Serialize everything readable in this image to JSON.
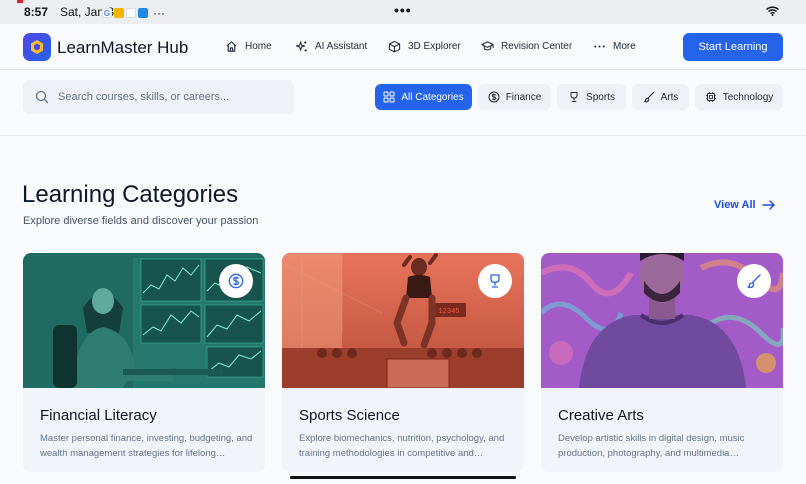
{
  "status": {
    "time": "8:57",
    "date": "Sat, Jan 3",
    "dots": "•••",
    "more": "···"
  },
  "nav": {
    "brand": "LearnMaster Hub",
    "items": [
      {
        "label": "Home",
        "icon": "home-icon"
      },
      {
        "label": "AI Assistant",
        "icon": "sparkles-icon"
      },
      {
        "label": "3D Explorer",
        "icon": "cube-icon"
      },
      {
        "label": "Revision Center",
        "icon": "graduation-cap-icon"
      },
      {
        "label": "More",
        "icon": "ellipsis-icon"
      }
    ],
    "cta": "Start Learning"
  },
  "search": {
    "placeholder": "Search courses, skills, or careers..."
  },
  "filters": [
    {
      "label": "All Categories",
      "icon": "grid-icon",
      "active": true
    },
    {
      "label": "Finance",
      "icon": "dollar-icon",
      "active": false
    },
    {
      "label": "Sports",
      "icon": "trophy-icon",
      "active": false
    },
    {
      "label": "Arts",
      "icon": "brush-icon",
      "active": false
    },
    {
      "label": "Technology",
      "icon": "chip-icon",
      "active": false
    }
  ],
  "section": {
    "title": "Learning Categories",
    "subtitle": "Explore diverse fields and discover your passion",
    "view_all": "View All"
  },
  "cards": [
    {
      "title": "Financial Literacy",
      "desc": "Master personal finance, investing, budgeting, and wealth management strategies for lifelong…",
      "icon": "dollar-icon"
    },
    {
      "title": "Sports Science",
      "desc": "Explore biomechanics, nutrition, psychology, and training methodologies in competitive and…",
      "icon": "trophy-icon"
    },
    {
      "title": "Creative Arts",
      "desc": "Develop artistic skills in digital design, music production, photography, and multimedia…",
      "icon": "brush-icon"
    }
  ],
  "colors": {
    "accent": "#2563eb",
    "finance_tint": "#2a9d8f",
    "sports_tint": "#e76f51",
    "arts_tint": "#9b5de5"
  }
}
